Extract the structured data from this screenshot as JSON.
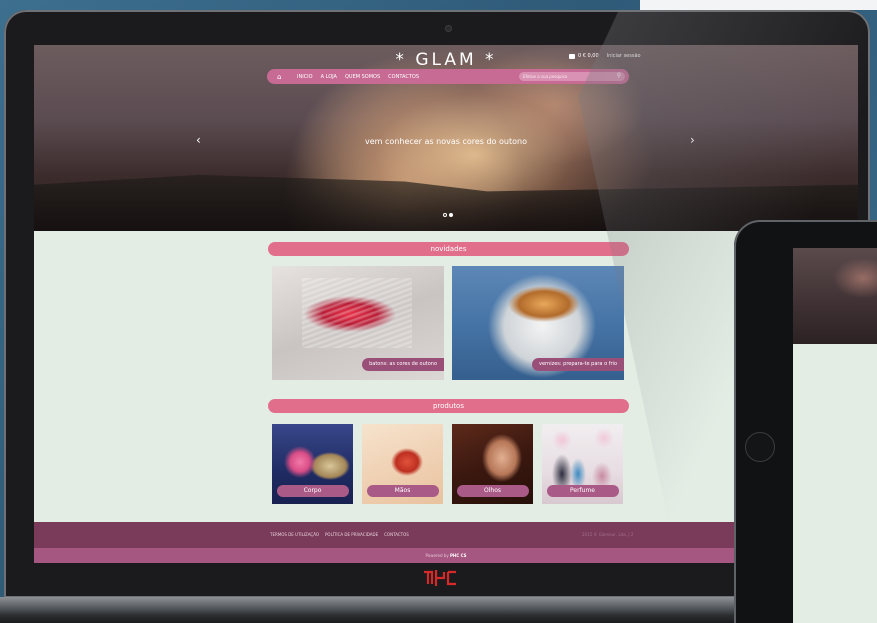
{
  "site": {
    "logo": "* GLAM *",
    "cart_total": "0 € 0,00",
    "login_label": "Iniciar sessão"
  },
  "nav": {
    "home_icon": "home-icon",
    "items": [
      "INICIO",
      "A LOJA",
      "QUEM SOMOS",
      "CONTACTOS"
    ],
    "search_placeholder": "Efetue a sua pesquisa"
  },
  "hero": {
    "caption": "vem conhecer as novas cores do outono",
    "prev_arrow": "‹",
    "next_arrow": "›"
  },
  "novidades": {
    "title": "novidades",
    "cards": [
      {
        "label": "batons: as cores de outono"
      },
      {
        "label": "vernizes: prepara-te para o frio"
      }
    ]
  },
  "produtos": {
    "title": "produtos",
    "cards": [
      {
        "label": "Corpo"
      },
      {
        "label": "Mãos"
      },
      {
        "label": "Olhos"
      },
      {
        "label": "Perfume"
      }
    ]
  },
  "footer": {
    "links": [
      "TERMOS DE UTILIZAÇÃO",
      "POLÍTICA DE PRIVACIDADE",
      "CONTACTOS"
    ],
    "copyright": "2015 © Glamour, Lda. | 2",
    "powered_prefix": "Powered by",
    "powered_brand": "PHC CS"
  },
  "colors": {
    "nav_pink": "#c76b95",
    "section_pink": "#e16f8c",
    "footer_plum": "#7a3b5a",
    "footer_bottom": "#a55681",
    "page_bg": "#e3ede4",
    "brand_red": "#d62a2a"
  }
}
